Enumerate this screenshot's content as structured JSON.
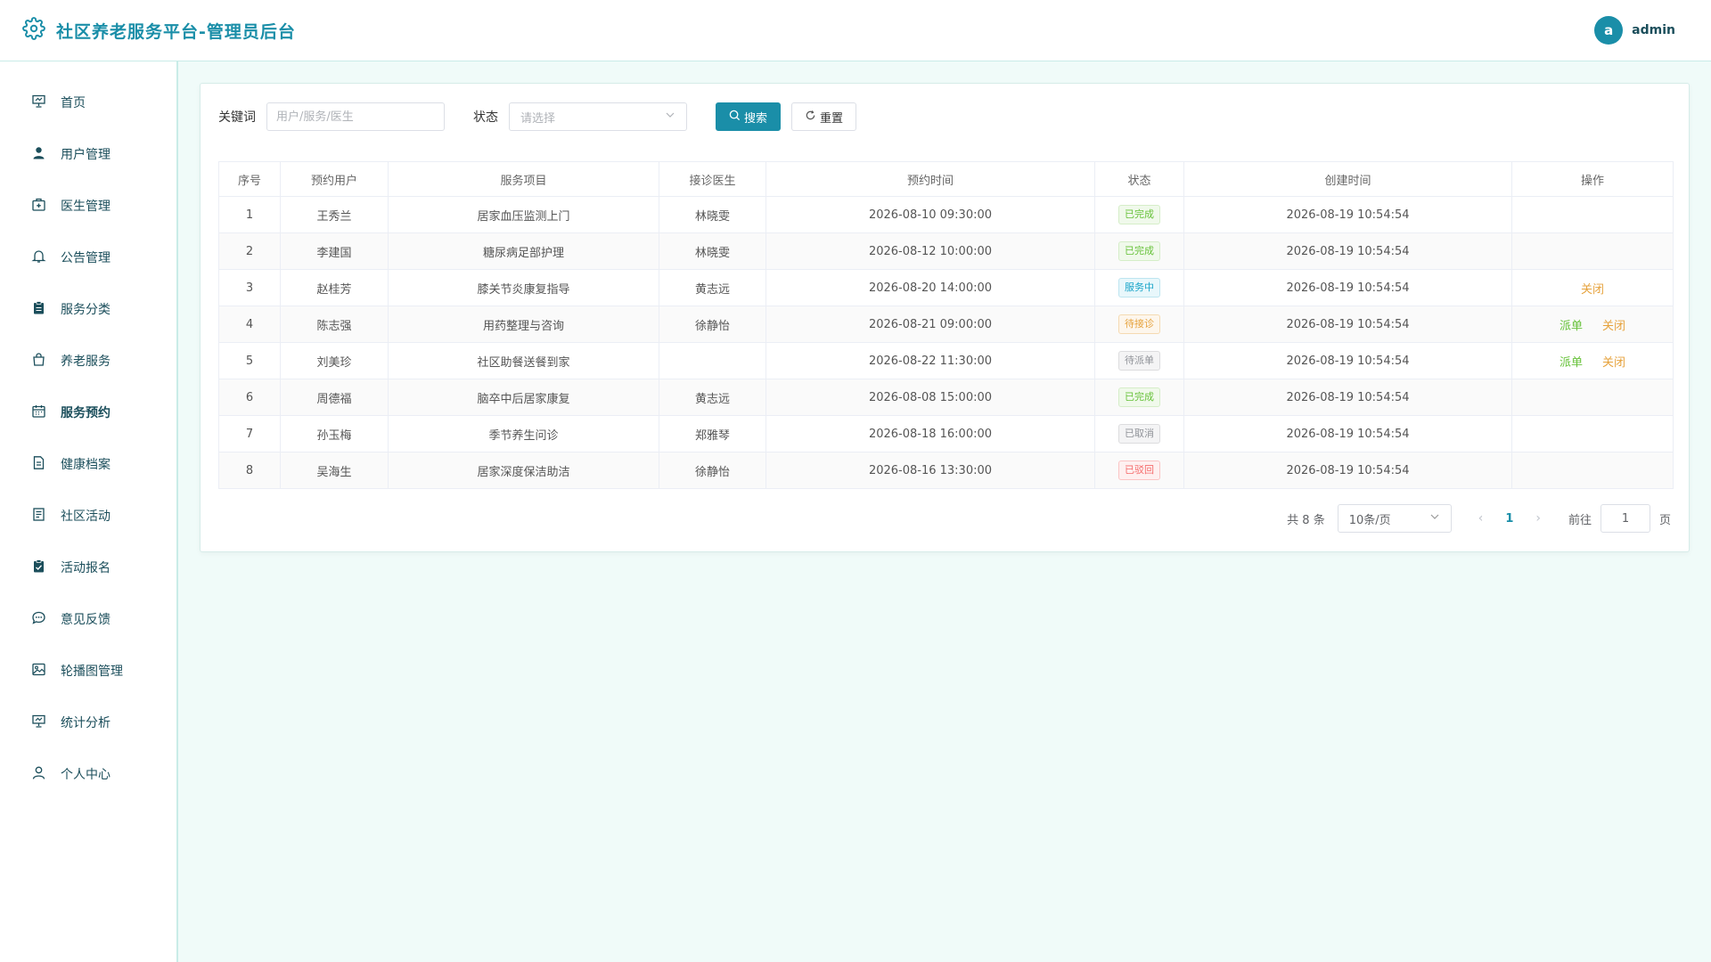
{
  "app": {
    "title": "社区养老服务平台-管理员后台",
    "brand_color": "#1a8ea8"
  },
  "user": {
    "avatar_letter": "a",
    "name": "admin"
  },
  "sidebar": {
    "items": [
      {
        "label": "首页",
        "icon": "dashboard-icon",
        "active": false
      },
      {
        "label": "用户管理",
        "icon": "user-icon",
        "active": false
      },
      {
        "label": "医生管理",
        "icon": "medical-box-icon",
        "active": false
      },
      {
        "label": "公告管理",
        "icon": "bell-icon",
        "active": false
      },
      {
        "label": "服务分类",
        "icon": "clipboard-icon",
        "active": false
      },
      {
        "label": "养老服务",
        "icon": "shopping-bag-icon",
        "active": false
      },
      {
        "label": "服务预约",
        "icon": "calendar-icon",
        "active": true
      },
      {
        "label": "健康档案",
        "icon": "document-icon",
        "active": false
      },
      {
        "label": "社区活动",
        "icon": "tickets-icon",
        "active": false
      },
      {
        "label": "活动报名",
        "icon": "checked-clipboard-icon",
        "active": false
      },
      {
        "label": "意见反馈",
        "icon": "chat-icon",
        "active": false
      },
      {
        "label": "轮播图管理",
        "icon": "picture-icon",
        "active": false
      },
      {
        "label": "统计分析",
        "icon": "presentation-icon",
        "active": false
      },
      {
        "label": "个人中心",
        "icon": "user-outline-icon",
        "active": false
      }
    ]
  },
  "filters": {
    "keyword_label": "关键词",
    "keyword_placeholder": "用户/服务/医生",
    "keyword_value": "",
    "status_label": "状态",
    "status_placeholder": "请选择",
    "search_label": "搜索",
    "reset_label": "重置"
  },
  "table": {
    "columns": [
      "序号",
      "预约用户",
      "服务项目",
      "接诊医生",
      "预约时间",
      "状态",
      "创建时间",
      "操作"
    ],
    "rows": [
      {
        "no": "1",
        "user": "王秀兰",
        "service": "居家血压监测上门",
        "doctor": "林晓雯",
        "time": "2026-08-10 09:30:00",
        "status": "已完成",
        "status_type": "success",
        "created": "2026-08-19 10:54:54",
        "actions": []
      },
      {
        "no": "2",
        "user": "李建国",
        "service": "糖尿病足部护理",
        "doctor": "林晓雯",
        "time": "2026-08-12 10:00:00",
        "status": "已完成",
        "status_type": "success",
        "created": "2026-08-19 10:54:54",
        "actions": []
      },
      {
        "no": "3",
        "user": "赵桂芳",
        "service": "膝关节炎康复指导",
        "doctor": "黄志远",
        "time": "2026-08-20 14:00:00",
        "status": "服务中",
        "status_type": "info",
        "created": "2026-08-19 10:54:54",
        "actions": [
          {
            "label": "关闭",
            "type": "orange"
          }
        ]
      },
      {
        "no": "4",
        "user": "陈志强",
        "service": "用药整理与咨询",
        "doctor": "徐静怡",
        "time": "2026-08-21 09:00:00",
        "status": "待接诊",
        "status_type": "warning",
        "created": "2026-08-19 10:54:54",
        "actions": [
          {
            "label": "派单",
            "type": "green"
          },
          {
            "label": "关闭",
            "type": "orange"
          }
        ]
      },
      {
        "no": "5",
        "user": "刘美珍",
        "service": "社区助餐送餐到家",
        "doctor": "",
        "time": "2026-08-22 11:30:00",
        "status": "待派单",
        "status_type": "gray",
        "created": "2026-08-19 10:54:54",
        "actions": [
          {
            "label": "派单",
            "type": "green"
          },
          {
            "label": "关闭",
            "type": "orange"
          }
        ]
      },
      {
        "no": "6",
        "user": "周德福",
        "service": "脑卒中后居家康复",
        "doctor": "黄志远",
        "time": "2026-08-08 15:00:00",
        "status": "已完成",
        "status_type": "success",
        "created": "2026-08-19 10:54:54",
        "actions": []
      },
      {
        "no": "7",
        "user": "孙玉梅",
        "service": "季节养生问诊",
        "doctor": "郑雅琴",
        "time": "2026-08-18 16:00:00",
        "status": "已取消",
        "status_type": "gray",
        "created": "2026-08-19 10:54:54",
        "actions": []
      },
      {
        "no": "8",
        "user": "吴海生",
        "service": "居家深度保洁助洁",
        "doctor": "徐静怡",
        "time": "2026-08-16 13:30:00",
        "status": "已驳回",
        "status_type": "danger",
        "created": "2026-08-19 10:54:54",
        "actions": []
      }
    ]
  },
  "pagination": {
    "total_text": "共 8 条",
    "page_size": "10条/页",
    "current_page": "1",
    "goto_label": "前往",
    "goto_value": "1",
    "page_suffix": "页"
  }
}
